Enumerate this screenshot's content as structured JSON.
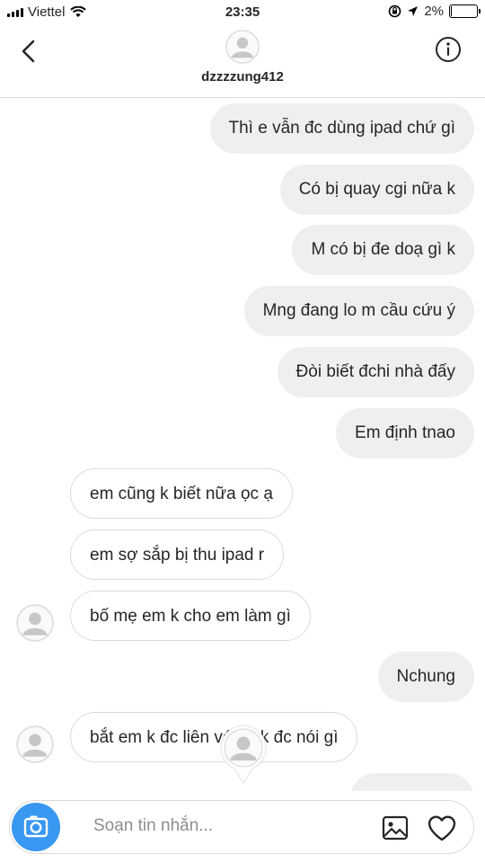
{
  "status_bar": {
    "carrier": "Viettel",
    "time": "23:35",
    "battery": "2%",
    "battery_level": 0.02
  },
  "header": {
    "username": "dzzzzung412"
  },
  "messages": [
    {
      "from": "me",
      "text": "Thì e vẫn đc dùng ipad chứ gì"
    },
    {
      "from": "me",
      "text": "Có bị quay cgi nữa k"
    },
    {
      "from": "me",
      "text": "M có bị đe doạ gì k"
    },
    {
      "from": "me",
      "text": "Mng đang lo m cầu cứu ý"
    },
    {
      "from": "me",
      "text": "Đòi biết đchi nhà đấy"
    },
    {
      "from": "me",
      "text": "Em định tnao"
    },
    {
      "from": "them",
      "text": "em cũng k biết nữa ọc ạ"
    },
    {
      "from": "them",
      "text": "em sợ sắp bị thu ipad r"
    },
    {
      "from": "them",
      "text": "bố mẹ em k cho em làm gì"
    },
    {
      "from": "me",
      "text": "Nchung"
    },
    {
      "from": "them",
      "text": "bắt em k đc liên với ai k đc nói gì"
    }
  ],
  "composer": {
    "placeholder": "Soạn tin nhắn..."
  },
  "icons": {
    "back": "chevron-left-icon",
    "info": "info-icon",
    "camera": "camera-icon",
    "gallery": "image-icon",
    "heart": "heart-icon",
    "avatar": "default-avatar-icon"
  },
  "colors": {
    "accent": "#3897f0",
    "outgoing_bubble": "#efefef",
    "border": "#dcdcdc",
    "placeholder": "#8e8e8e"
  }
}
